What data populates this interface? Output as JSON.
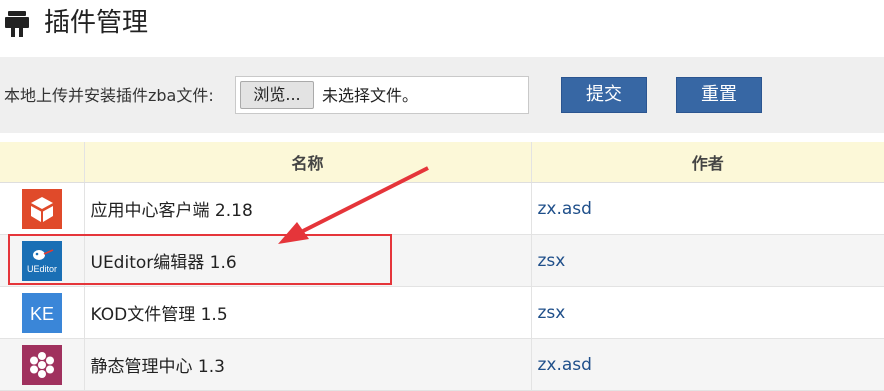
{
  "header": {
    "title": "插件管理",
    "icon": "plug-icon"
  },
  "upload": {
    "label": "本地上传并安装插件zba文件:",
    "browse_label": "浏览...",
    "file_status": "未选择文件。",
    "submit_label": "提交",
    "reset_label": "重置"
  },
  "table": {
    "columns": [
      "",
      "名称",
      "作者"
    ],
    "rows": [
      {
        "name": "应用中心客户端 2.18",
        "author": "zx.asd",
        "icon": "app-center-icon",
        "icon_color": "#e04a2a"
      },
      {
        "name": "UEditor编辑器 1.6",
        "author": "zsx",
        "icon": "ueditor-icon",
        "icon_color": "#1a6fb5",
        "icon_text": "UEditor"
      },
      {
        "name": "KOD文件管理 1.5",
        "author": "zsx",
        "icon": "kod-icon",
        "icon_color": "#3a86d8",
        "icon_text": "KE"
      },
      {
        "name": "静态管理中心 1.3",
        "author": "zx.asd",
        "icon": "static-center-icon",
        "icon_color": "#a0315e"
      }
    ]
  },
  "annotation": {
    "color": "#e5353a"
  }
}
